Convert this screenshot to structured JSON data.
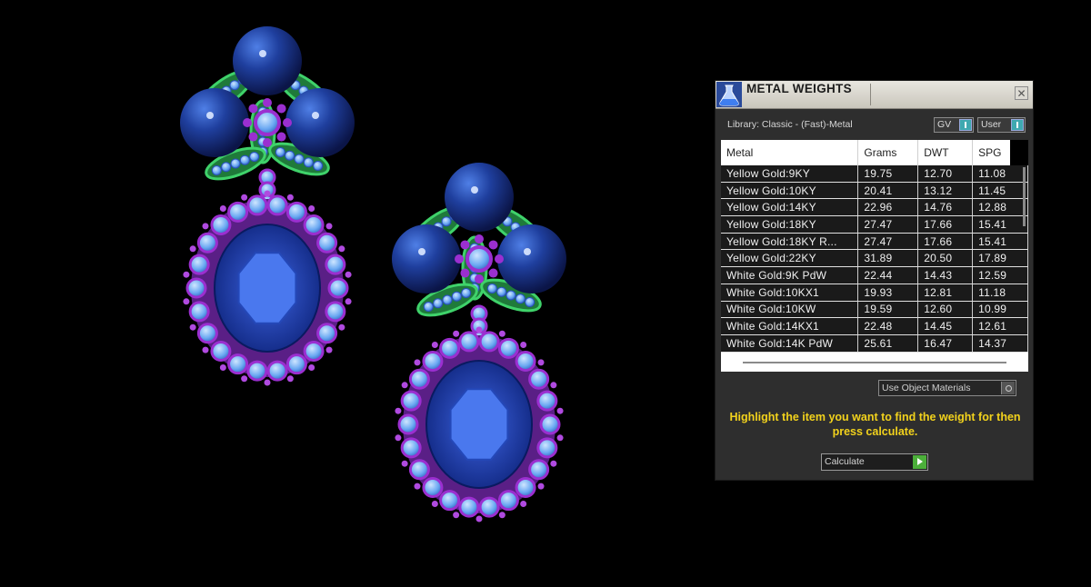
{
  "panel": {
    "title": "METAL WEIGHTS",
    "close_label": "✕",
    "library_label": "Library: Classic - (Fast)-Metal",
    "toggle_gv": "GV",
    "toggle_user": "User",
    "columns": [
      "Metal",
      "Grams",
      "DWT",
      "SPG"
    ],
    "rows": [
      [
        "Yellow Gold:9KY",
        "19.75",
        "12.70",
        "11.08"
      ],
      [
        "Yellow Gold:10KY",
        "20.41",
        "13.12",
        "11.45"
      ],
      [
        "Yellow Gold:14KY",
        "22.96",
        "14.76",
        "12.88"
      ],
      [
        "Yellow Gold:18KY",
        "27.47",
        "17.66",
        "15.41"
      ],
      [
        "Yellow Gold:18KY R...",
        "27.47",
        "17.66",
        "15.41"
      ],
      [
        "Yellow Gold:22KY",
        "31.89",
        "20.50",
        "17.89"
      ],
      [
        "White Gold:9K PdW",
        "22.44",
        "14.43",
        "12.59"
      ],
      [
        "White Gold:10KX1",
        "19.93",
        "12.81",
        "11.18"
      ],
      [
        "White Gold:10KW",
        "19.59",
        "12.60",
        "10.99"
      ],
      [
        "White Gold:14KX1",
        "22.48",
        "14.45",
        "12.61"
      ],
      [
        "White Gold:14K PdW",
        "25.61",
        "16.47",
        "14.37"
      ]
    ],
    "materials_dropdown": "Use Object Materials",
    "instruction": "Highlight the item you want to find the weight for then press calculate.",
    "calculate_label": "Calculate"
  },
  "colors": {
    "background": "#000000",
    "panel": "#2e2e2e",
    "instruction": "#f2d21c",
    "sapphire": "#1f3fae",
    "pearl": "#1a3fa0",
    "leaf": "#3fd26a",
    "bezel": "#9b2fd0",
    "accent_stone": "#7fb8ff"
  }
}
